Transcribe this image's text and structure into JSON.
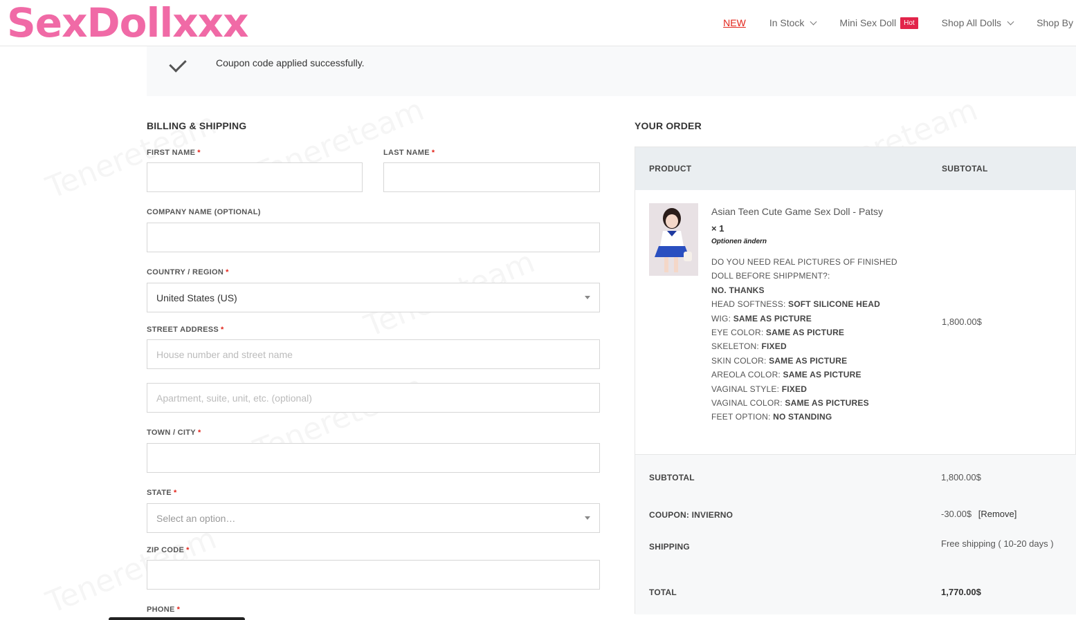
{
  "header": {
    "logo": "SexDollxxx",
    "nav": {
      "new": "NEW",
      "in_stock": "In Stock",
      "mini": "Mini Sex Doll",
      "hot_badge": "Hot",
      "shop_all": "Shop All Dolls",
      "shop_by": "Shop By"
    }
  },
  "notice": {
    "text": "Coupon code applied successfully."
  },
  "billing": {
    "title": "BILLING & SHIPPING",
    "required_mark": "*",
    "first_name_label": "FIRST NAME",
    "last_name_label": "LAST NAME",
    "company_label": "COMPANY NAME (OPTIONAL)",
    "country_label": "COUNTRY / REGION",
    "country_value": "United States (US)",
    "street_label": "STREET ADDRESS",
    "street_placeholder": "House number and street name",
    "street2_placeholder": "Apartment, suite, unit, etc. (optional)",
    "city_label": "TOWN / CITY",
    "state_label": "STATE",
    "state_value": "Select an option…",
    "zip_label": "ZIP CODE",
    "phone_label": "PHONE"
  },
  "order": {
    "title": "YOUR ORDER",
    "col_product": "PRODUCT",
    "col_subtotal": "SUBTOTAL",
    "product_name": "Asian Teen Cute Game Sex Doll - Patsy",
    "qty": "× 1",
    "change_options": "Optionen ändern",
    "attributes": [
      {
        "k": "DO YOU NEED REAL PICTURES OF FINISHED DOLL BEFORE SHIPPMENT?:",
        "v": "NO. THANKS"
      },
      {
        "k": "HEAD SOFTNESS:",
        "v": "SOFT SILICONE HEAD"
      },
      {
        "k": "WIG:",
        "v": "SAME AS PICTURE"
      },
      {
        "k": "EYE COLOR:",
        "v": "SAME AS PICTURE"
      },
      {
        "k": "SKELETON:",
        "v": "FIXED"
      },
      {
        "k": "SKIN COLOR:",
        "v": "SAME AS PICTURE"
      },
      {
        "k": "AREOLA COLOR:",
        "v": "SAME AS PICTURE"
      },
      {
        "k": "VAGINAL STYLE:",
        "v": "FIXED"
      },
      {
        "k": "VAGINAL COLOR:",
        "v": "SAME AS PICTURES"
      },
      {
        "k": "FEET OPTION:",
        "v": "NO STANDING"
      }
    ],
    "product_subtotal": "1,800.00$",
    "subtotal_label": "SUBTOTAL",
    "subtotal_value": "1,800.00$",
    "coupon_label": "COUPON: INVIERNO",
    "coupon_value": "-30.00$",
    "coupon_remove": "[Remove]",
    "shipping_label": "SHIPPING",
    "shipping_value": "Free shipping ( 10-20 days )",
    "total_label": "TOTAL",
    "total_value": "1,770.00$"
  },
  "colors": {
    "logo": "#f06aa6",
    "accent_red": "#e2241a",
    "hot_badge": "#e2244a",
    "order_head_bg": "#eaeef1"
  }
}
